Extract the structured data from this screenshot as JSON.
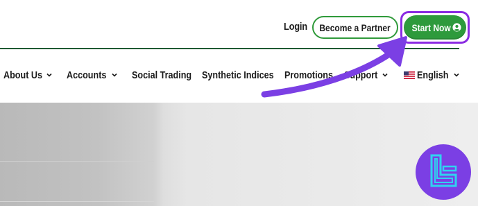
{
  "header": {
    "login_label": "Login",
    "partner_label": "Become a Partner",
    "start_label": "Start Now",
    "start_icon": "user-circle-icon"
  },
  "nav": {
    "items": [
      {
        "label": "About Us",
        "has_dropdown": true
      },
      {
        "label": "Accounts",
        "has_dropdown": true
      },
      {
        "label": "Social Trading",
        "has_dropdown": false
      },
      {
        "label": "Synthetic Indices",
        "has_dropdown": false
      },
      {
        "label": "Promotions",
        "has_dropdown": false
      },
      {
        "label": "Support",
        "has_dropdown": true
      },
      {
        "label": "English",
        "has_dropdown": true,
        "icon": "us-flag-icon"
      }
    ]
  },
  "colors": {
    "brand_green": "#2e9a3c",
    "divider_green": "#1f5a33",
    "highlight_purple": "#8a2be2",
    "annotation_arrow": "#7b3fe4",
    "logo_cyan": "#2fd3f0"
  },
  "annotation": {
    "arrow_icon": "curved-arrow-icon",
    "watermark_icon": "tc-logo-icon"
  }
}
